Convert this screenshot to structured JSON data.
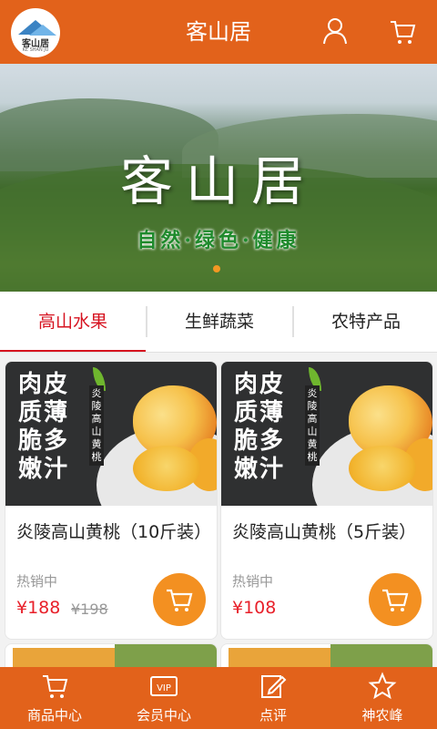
{
  "header": {
    "title": "客山居",
    "logo_text": "客山居",
    "logo_subtext": "KE SHAN JU",
    "user_icon": "user-icon",
    "cart_icon": "cart-icon"
  },
  "banner": {
    "title": "客山居",
    "subtitle": "自然·绿色·健康",
    "slide_count": 1,
    "active_slide": 1
  },
  "tabs": [
    {
      "label": "高山水果",
      "active": true
    },
    {
      "label": "生鲜蔬菜",
      "active": false
    },
    {
      "label": "农特产品",
      "active": false
    }
  ],
  "products": [
    {
      "image_text": "肉皮质薄脆多嫩汁",
      "image_side_text": "炎陵高山黄桃",
      "name": "炎陵高山黄桃（10斤装）",
      "status": "热销中",
      "price": "¥188",
      "old_price": "¥198"
    },
    {
      "image_text": "肉皮质薄脆多嫩汁",
      "image_side_text": "炎陵高山黄桃",
      "name": "炎陵高山黄桃（5斤装）",
      "status": "热销中",
      "price": "¥108",
      "old_price": ""
    }
  ],
  "bottom_nav": [
    {
      "label": "商品中心",
      "icon": "cart-icon"
    },
    {
      "label": "会员中心",
      "icon": "vip-icon"
    },
    {
      "label": "点评",
      "icon": "edit-icon"
    },
    {
      "label": "神农峰",
      "icon": "star-icon"
    }
  ],
  "colors": {
    "brand": "#e2621b",
    "accent": "#f39021",
    "price": "#e8202a",
    "active_tab": "#d6121f"
  }
}
